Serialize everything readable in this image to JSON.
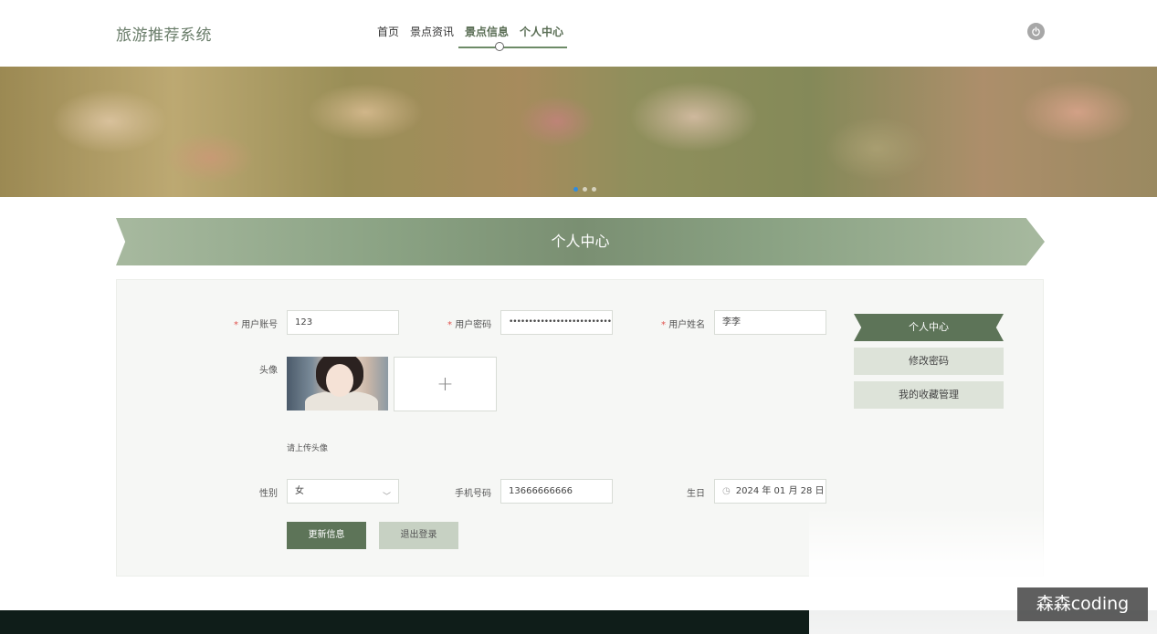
{
  "header": {
    "logo": "旅游推荐系统",
    "nav": [
      {
        "label": "首页",
        "active": false
      },
      {
        "label": "景点资讯",
        "active": false
      },
      {
        "label": "景点信息",
        "active": true
      },
      {
        "label": "个人中心",
        "active": true
      }
    ],
    "power_icon": "power-icon"
  },
  "banner": {
    "carousel_dots": 3,
    "active_dot": 1
  },
  "page_title": "个人中心",
  "form": {
    "account": {
      "label": "用户账号",
      "value": "123",
      "required": true
    },
    "password": {
      "label": "用户密码",
      "value": "••••••••••••••••••••••••••••••••",
      "required": true
    },
    "name": {
      "label": "用户姓名",
      "value": "李李",
      "required": true
    },
    "avatar": {
      "label": "头像",
      "upload_icon": "plus-icon",
      "upload_glyph": "+",
      "hint": "请上传头像"
    },
    "gender": {
      "label": "性别",
      "value": "女"
    },
    "phone": {
      "label": "手机号码",
      "value": "13666666666"
    },
    "birthday": {
      "label": "生日",
      "value": "2024 年 01 月 28 日"
    },
    "update_button": "更新信息",
    "logout_button": "退出登录"
  },
  "side_menu": [
    {
      "label": "个人中心",
      "active": true
    },
    {
      "label": "修改密码",
      "active": false
    },
    {
      "label": "我的收藏管理",
      "active": false
    }
  ],
  "watermark": "森森coding",
  "colors": {
    "primary": "#5d7458",
    "accent": "#8aa283",
    "required": "#e0534e",
    "footer": "#0f1d19"
  }
}
